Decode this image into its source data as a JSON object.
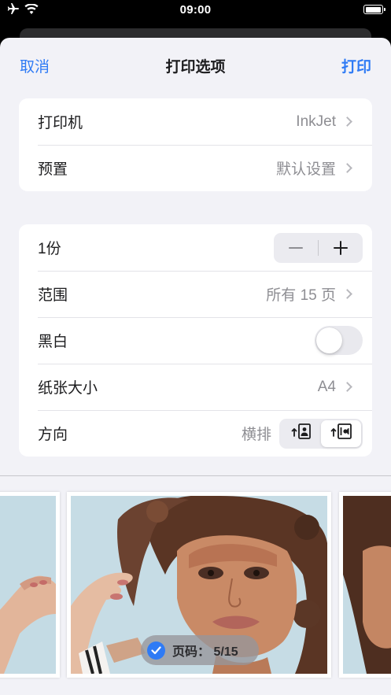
{
  "status_bar": {
    "time": "09:00",
    "icons": [
      "airplane-icon",
      "wifi-icon",
      "battery-icon"
    ]
  },
  "nav": {
    "cancel_label": "取消",
    "title": "打印选项",
    "print_label": "打印"
  },
  "group1": {
    "printer": {
      "label": "打印机",
      "value": "InkJet"
    },
    "preset": {
      "label": "预置",
      "value": "默认设置"
    }
  },
  "group2": {
    "copies": {
      "label": "1份"
    },
    "range": {
      "label": "范围",
      "value": "所有 15 页"
    },
    "bw": {
      "label": "黑白",
      "enabled": false
    },
    "paper": {
      "label": "纸张大小",
      "value": "A4"
    },
    "orientation": {
      "label": "方向",
      "value": "横排",
      "options": [
        "portrait-icon",
        "landscape-icon"
      ],
      "selected": "landscape-icon"
    }
  },
  "preview": {
    "badge": "页码：  5/15",
    "badge_checked": true
  },
  "colors": {
    "accent": "#2f7bf5",
    "background": "#f2f2f7",
    "secondary_text": "#8e8e93"
  }
}
